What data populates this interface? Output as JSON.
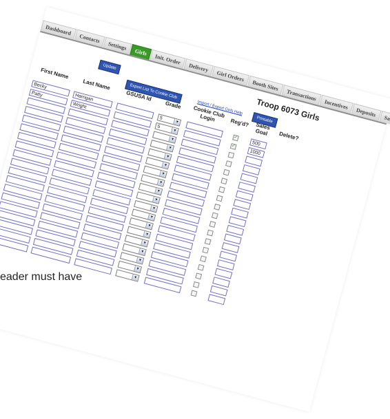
{
  "tabs": [
    {
      "label": "Dashboard",
      "active": false
    },
    {
      "label": "Contacts",
      "active": false
    },
    {
      "label": "Settings",
      "active": false
    },
    {
      "label": "Girls",
      "active": true
    },
    {
      "label": "Init. Order",
      "active": false
    },
    {
      "label": "Delivery",
      "active": false
    },
    {
      "label": "Girl Orders",
      "active": false
    },
    {
      "label": "Booth Sites",
      "active": false
    },
    {
      "label": "Transactions",
      "active": false
    },
    {
      "label": "Incentives",
      "active": false
    },
    {
      "label": "Deposits",
      "active": false
    },
    {
      "label": "Sales Repo",
      "active": false
    }
  ],
  "troop_title": "Troop 6073 Girls",
  "toolbar": {
    "update_label": "Update",
    "export_label": "Export List To Cookie Club",
    "import_link": "Import / Export Girls Help",
    "printable_label": "Printable"
  },
  "columns": {
    "first_name": "First Name",
    "last_name": "Last Name",
    "gsusa_id": "GSUSA Id",
    "grade": "Grade",
    "cookie_club_login": "Cookie Club Login",
    "regd": "Reg'd?",
    "sales_goal": "Sales Goal",
    "delete": "Delete?"
  },
  "rows": [
    {
      "first": "Becky",
      "last": "Harrigan",
      "gsusa": "",
      "grade": "5",
      "login": "",
      "regd": true,
      "goal": "500"
    },
    {
      "first": "Patty",
      "last": "Wright",
      "gsusa": "",
      "grade": "5",
      "login": "",
      "regd": true,
      "goal": "1000"
    },
    {
      "first": "",
      "last": "",
      "gsusa": "",
      "grade": "",
      "login": "",
      "regd": false,
      "goal": ""
    },
    {
      "first": "",
      "last": "",
      "gsusa": "",
      "grade": "",
      "login": "",
      "regd": false,
      "goal": ""
    },
    {
      "first": "",
      "last": "",
      "gsusa": "",
      "grade": "",
      "login": "",
      "regd": false,
      "goal": ""
    },
    {
      "first": "",
      "last": "",
      "gsusa": "",
      "grade": "",
      "login": "",
      "regd": false,
      "goal": ""
    },
    {
      "first": "",
      "last": "",
      "gsusa": "",
      "grade": "",
      "login": "",
      "regd": false,
      "goal": ""
    },
    {
      "first": "",
      "last": "",
      "gsusa": "",
      "grade": "",
      "login": "",
      "regd": false,
      "goal": ""
    },
    {
      "first": "",
      "last": "",
      "gsusa": "",
      "grade": "",
      "login": "",
      "regd": false,
      "goal": ""
    },
    {
      "first": "",
      "last": "",
      "gsusa": "",
      "grade": "",
      "login": "",
      "regd": false,
      "goal": ""
    },
    {
      "first": "",
      "last": "",
      "gsusa": "",
      "grade": "",
      "login": "",
      "regd": false,
      "goal": ""
    },
    {
      "first": "",
      "last": "",
      "gsusa": "",
      "grade": "",
      "login": "",
      "regd": false,
      "goal": ""
    },
    {
      "first": "",
      "last": "",
      "gsusa": "",
      "grade": "",
      "login": "",
      "regd": false,
      "goal": ""
    },
    {
      "first": "",
      "last": "",
      "gsusa": "",
      "grade": "",
      "login": "",
      "regd": false,
      "goal": ""
    },
    {
      "first": "",
      "last": "",
      "gsusa": "",
      "grade": "",
      "login": "",
      "regd": false,
      "goal": ""
    },
    {
      "first": "",
      "last": "",
      "gsusa": "",
      "grade": "",
      "login": "",
      "regd": false,
      "goal": ""
    },
    {
      "first": "",
      "last": "",
      "gsusa": "",
      "grade": "",
      "login": "",
      "regd": false,
      "goal": ""
    },
    {
      "first": "",
      "last": "",
      "gsusa": "",
      "grade": "",
      "login": "",
      "regd": false,
      "goal": ""
    },
    {
      "first": "",
      "last": "",
      "gsusa": "",
      "grade": "",
      "login": "",
      "regd": false,
      "goal": ""
    }
  ],
  "caption_fragment": "eader must have",
  "colors": {
    "active_tab": "#3a9a28",
    "button": "#2f55b0",
    "input_border": "#6f6fc6",
    "check": "#2a8a1c"
  },
  "icons": {
    "dropdown": "chevron-down-icon",
    "checkbox_checked": "check-icon"
  }
}
